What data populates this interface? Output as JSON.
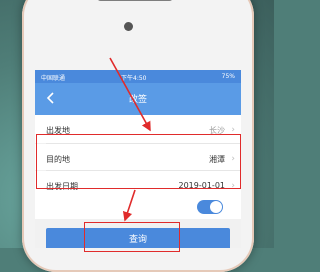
{
  "status": {
    "carrier": "中国联通",
    "time": "下午4:50",
    "battery": "75%"
  },
  "nav": {
    "title": "改签"
  },
  "form": {
    "departure_label": "出发地",
    "departure_value": "长沙",
    "destination_label": "目的地",
    "destination_value": "湘潭",
    "date_label": "出发日期",
    "date_value": "2019-01-01"
  },
  "toggle": {
    "on": true
  },
  "query_button": {
    "label": "查询"
  },
  "colors": {
    "accent": "#4a89dc",
    "highlight": "#e02b2b",
    "background": "#4f7e78"
  }
}
